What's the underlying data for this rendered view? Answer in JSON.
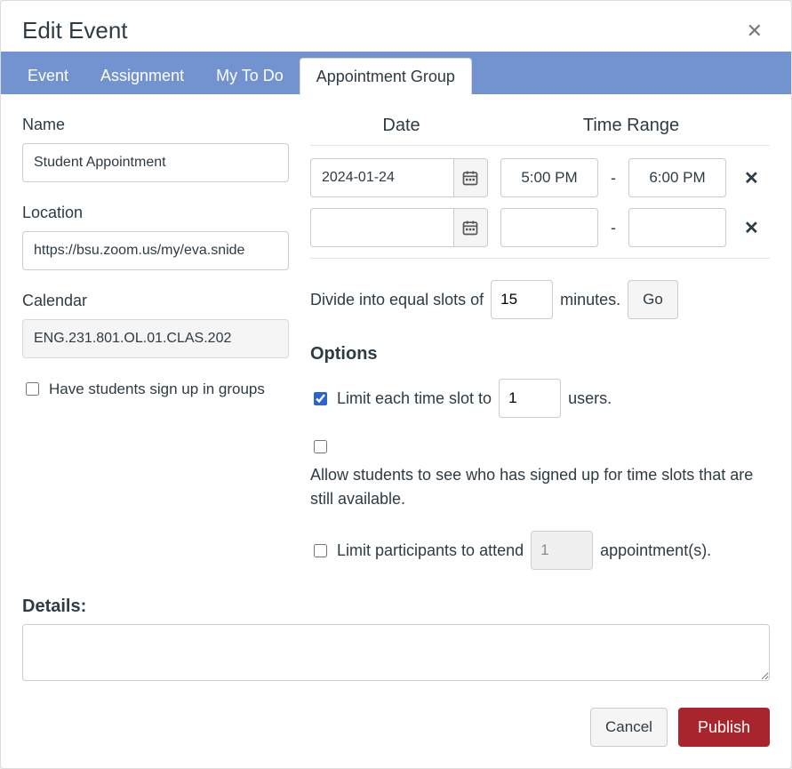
{
  "modal": {
    "title": "Edit Event",
    "close_aria": "Close"
  },
  "tabs": {
    "event": "Event",
    "assignment": "Assignment",
    "mytodo": "My To Do",
    "appointment_group": "Appointment Group"
  },
  "left": {
    "name_label": "Name",
    "name_value": "Student Appointment",
    "location_label": "Location",
    "location_value": "https://bsu.zoom.us/my/eva.snide",
    "calendar_label": "Calendar",
    "calendar_value": "ENG.231.801.OL.01.CLAS.202",
    "group_signup_label": "Have students sign up in groups"
  },
  "right": {
    "date_header": "Date",
    "time_header": "Time Range",
    "rows": [
      {
        "date": "2024-01-24",
        "start": "5:00 PM",
        "end": "6:00 PM"
      },
      {
        "date": "",
        "start": "",
        "end": ""
      }
    ],
    "divide_text_before": "Divide into equal slots of",
    "divide_value": "15",
    "divide_text_after": "minutes.",
    "go_label": "Go",
    "options_label": "Options",
    "limit_slot_text_before": "Limit each time slot to",
    "limit_slot_value": "1",
    "limit_slot_text_after": "users.",
    "allow_see_text": "Allow students to see who has signed up for time slots that are still available.",
    "limit_participants_text_before": "Limit participants to attend",
    "limit_participants_value": "1",
    "limit_participants_text_after": "appointment(s)."
  },
  "details": {
    "label": "Details:",
    "value": ""
  },
  "footer": {
    "cancel": "Cancel",
    "publish": "Publish"
  }
}
